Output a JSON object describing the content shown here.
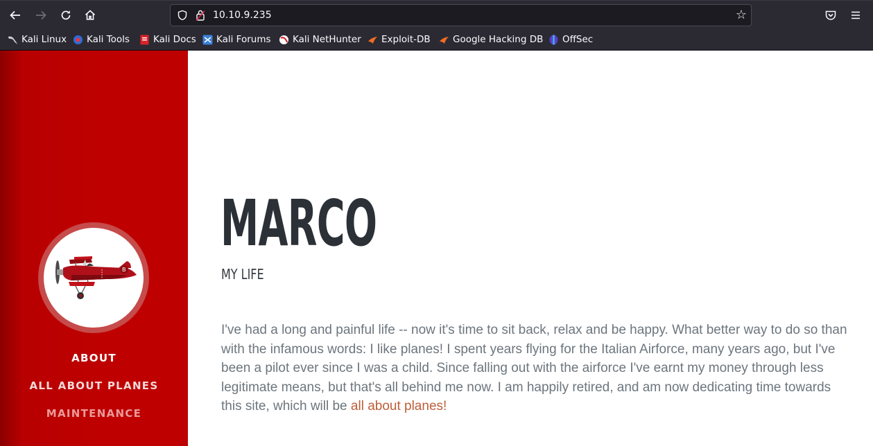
{
  "browser": {
    "url": "10.10.9.235",
    "bookmarks": [
      {
        "label": "Kali Linux",
        "icon": "kali-dragon-icon"
      },
      {
        "label": "Kali Tools",
        "icon": "kali-tools-icon"
      },
      {
        "label": "Kali Docs",
        "icon": "kali-docs-icon"
      },
      {
        "label": "Kali Forums",
        "icon": "kali-forums-icon"
      },
      {
        "label": "Kali NetHunter",
        "icon": "kali-nethunter-icon"
      },
      {
        "label": "Exploit-DB",
        "icon": "exploit-db-icon"
      },
      {
        "label": "Google Hacking DB",
        "icon": "ghdb-icon"
      },
      {
        "label": "OffSec",
        "icon": "offsec-icon"
      }
    ]
  },
  "sidebar": {
    "menu": [
      {
        "label": "About"
      },
      {
        "label": "All About Planes"
      },
      {
        "label": "Maintenance"
      }
    ],
    "colors": {
      "background": "#bf0000",
      "ring": "#c64b4b"
    }
  },
  "main": {
    "title": "MARCO",
    "subtitle": "MY LIFE",
    "paragraph_text": "I've had a long and painful life -- now it's time to sit back, relax and be happy. What better way to do so than with the infamous words: I like planes! I spent years flying for the Italian Airforce, many years ago, but I've been a pilot ever since I was a child. Since falling out with the airforce I've earnt my money through less legitimate means, but that's all behind me now. I am happily retired, and am now dedicating time towards this site, which will be ",
    "paragraph_link": "all about planes!",
    "colors": {
      "link": "#bd5d38",
      "text": "#6c757d"
    }
  }
}
